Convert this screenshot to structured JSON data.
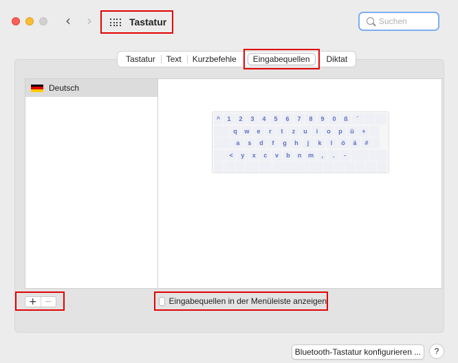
{
  "window": {
    "title": "Tastatur",
    "back_icon": "chevron-left-icon",
    "forward_icon": "chevron-right-icon",
    "grid_icon": "show-all-grid-icon"
  },
  "search": {
    "placeholder": "Suchen",
    "value": ""
  },
  "tabs": [
    {
      "label": "Tastatur"
    },
    {
      "label": "Text"
    },
    {
      "label": "Kurzbefehle"
    },
    {
      "label": "Eingabequellen",
      "active": true
    },
    {
      "label": "Diktat"
    }
  ],
  "input_sources": {
    "items": [
      {
        "label": "Deutsch",
        "icon": "german-flag-icon"
      }
    ]
  },
  "keyboard_layout": {
    "rows": [
      [
        "^",
        "1",
        "2",
        "3",
        "4",
        "5",
        "6",
        "7",
        "8",
        "9",
        "0",
        "ß",
        "´",
        "",
        ""
      ],
      [
        "",
        "q",
        "w",
        "e",
        "r",
        "t",
        "z",
        "u",
        "i",
        "o",
        "p",
        "ü",
        "+",
        ""
      ],
      [
        "",
        "a",
        "s",
        "d",
        "f",
        "g",
        "h",
        "j",
        "k",
        "l",
        "ö",
        "ä",
        "#",
        ""
      ],
      [
        "",
        "<",
        "y",
        "x",
        "c",
        "v",
        "b",
        "n",
        "m",
        ",",
        ".",
        "-",
        "",
        ""
      ],
      [
        "",
        "",
        "",
        "",
        "",
        "",
        "",
        "",
        "",
        "",
        "",
        "",
        ""
      ]
    ]
  },
  "controls": {
    "add_label": "+",
    "remove_label": "−",
    "show_in_menu_bar_label": "Eingabequellen in der Menüleiste anzeigen",
    "show_in_menu_bar_checked": false,
    "bluetooth_button_label": "Bluetooth-Tastatur konfigurieren ...",
    "help_label": "?"
  },
  "colors": {
    "highlight": "#e10000",
    "key_text": "#5d6fc4",
    "search_focus": "#7aaef2"
  }
}
